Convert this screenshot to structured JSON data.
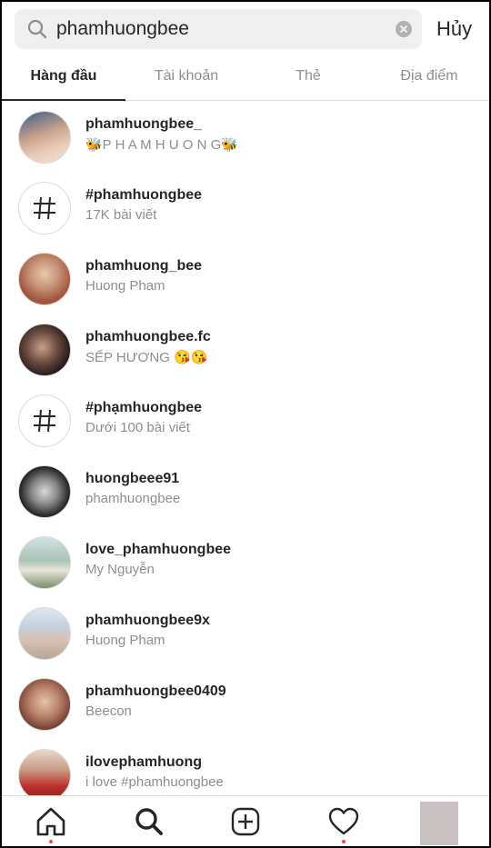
{
  "search": {
    "query": "phamhuongbee",
    "cancel_label": "Hủy"
  },
  "tabs": [
    {
      "label": "Hàng đầu",
      "active": true
    },
    {
      "label": "Tài khoản",
      "active": false
    },
    {
      "label": "Thẻ",
      "active": false
    },
    {
      "label": "Địa điểm",
      "active": false
    }
  ],
  "results": [
    {
      "type": "account",
      "title": "phamhuongbee_",
      "subtitle": "🐝P H A M H U O N G🐝"
    },
    {
      "type": "hashtag",
      "title": "#phamhuongbee",
      "subtitle": "17K bài viết"
    },
    {
      "type": "account",
      "title": "phamhuong_bee",
      "subtitle": "Huong Pham"
    },
    {
      "type": "account",
      "title": "phamhuongbee.fc",
      "subtitle": "SẾP HƯƠNG 😘😘"
    },
    {
      "type": "hashtag",
      "title": "#phạmhuongbee",
      "subtitle": "Dưới 100 bài viết"
    },
    {
      "type": "account",
      "title": "huongbeee91",
      "subtitle": "phamhuongbee"
    },
    {
      "type": "account",
      "title": "love_phamhuongbee",
      "subtitle": "My Nguyễn"
    },
    {
      "type": "account",
      "title": "phamhuongbee9x",
      "subtitle": "Huong Pham"
    },
    {
      "type": "account",
      "title": "phamhuongbee0409",
      "subtitle": "Beecon"
    },
    {
      "type": "account",
      "title": "ilovephamhuong",
      "subtitle": "i love #phamhuongbee"
    }
  ],
  "colors": {
    "accent": "#262626",
    "muted": "#8e8e8e",
    "notification_dot": "#ed4956"
  },
  "bottom_nav": [
    "home-icon",
    "search-icon",
    "add-icon",
    "heart-icon",
    "profile"
  ]
}
